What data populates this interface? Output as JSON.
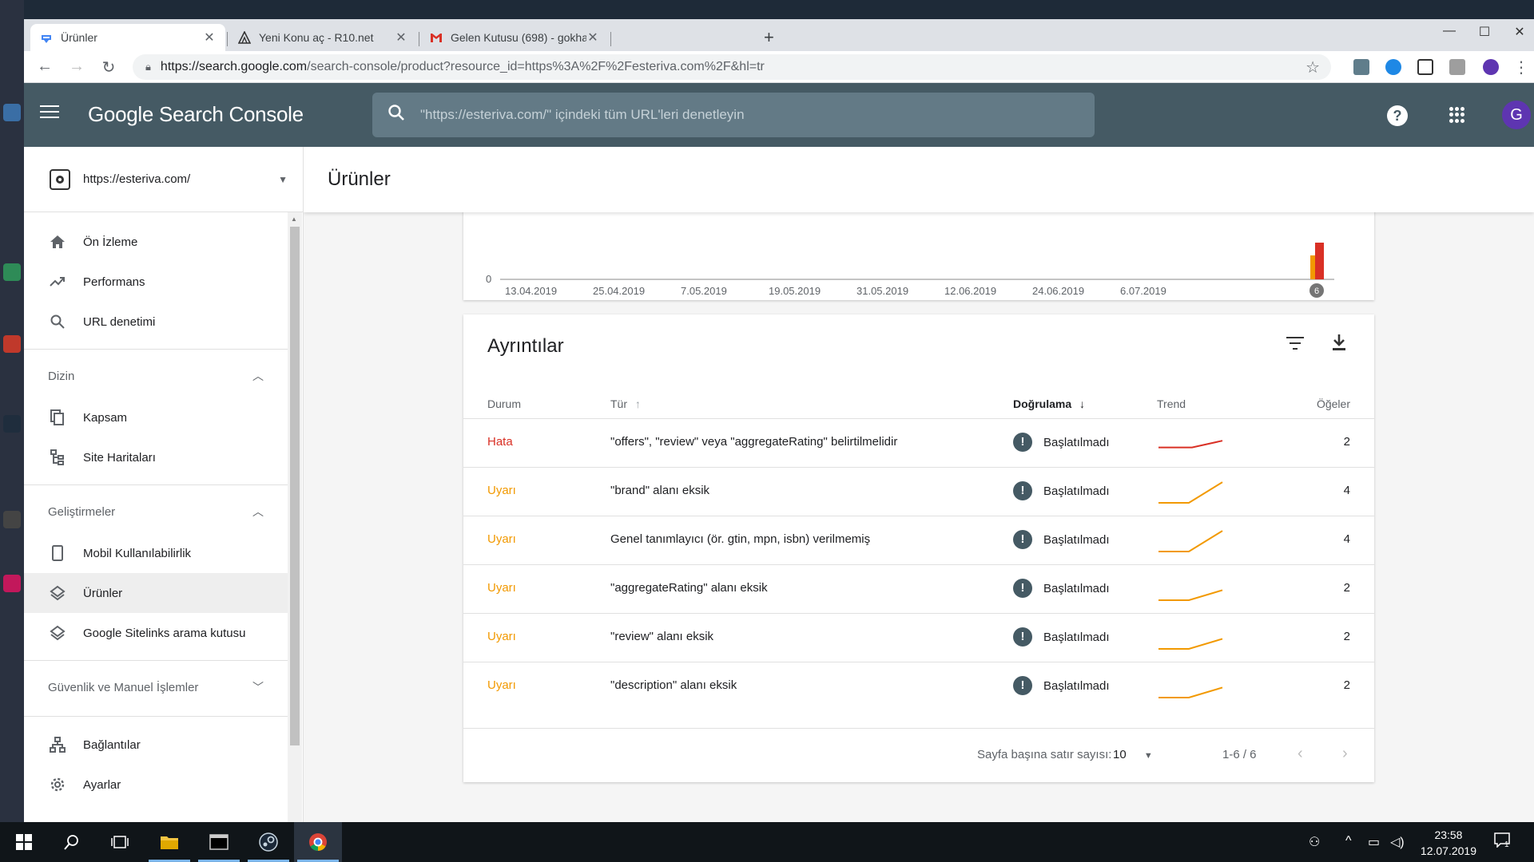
{
  "browser": {
    "tabs": [
      {
        "title": "Ürünler",
        "favicon": "search-console-icon",
        "active": true
      },
      {
        "title": "Yeni Konu aç - R10.net",
        "favicon": "r10-icon",
        "active": false
      },
      {
        "title": "Gelen Kutusu (698) - gokhanpola",
        "favicon": "gmail-icon",
        "active": false
      }
    ],
    "url_host": "https://search.google.com",
    "url_path": "/search-console/product?resource_id=https%3A%2F%2Festeriva.com%2F&hl=tr"
  },
  "header": {
    "brand_google": "Google",
    "brand_product": "Search Console",
    "search_placeholder": "\"https://esteriva.com/\" içindeki tüm URL'leri denetleyin",
    "avatar_letter": "G"
  },
  "sidebar": {
    "property": "https://esteriva.com/",
    "items_top": [
      {
        "label": "Ön İzleme",
        "icon": "home-icon"
      },
      {
        "label": "Performans",
        "icon": "trending-icon"
      },
      {
        "label": "URL denetimi",
        "icon": "search-icon"
      }
    ],
    "section_index": "Dizin",
    "items_index": [
      {
        "label": "Kapsam",
        "icon": "copy-icon"
      },
      {
        "label": "Site Haritaları",
        "icon": "sitemap-icon"
      }
    ],
    "section_enh": "Geliştirmeler",
    "items_enh": [
      {
        "label": "Mobil Kullanılabilirlik",
        "icon": "phone-icon"
      },
      {
        "label": "Ürünler",
        "icon": "layers-icon",
        "active": true
      },
      {
        "label": "Google Sitelinks arama kutusu",
        "icon": "layers-icon"
      }
    ],
    "section_security": "Güvenlik ve Manuel İşlemler",
    "items_bottom": [
      {
        "label": "Bağlantılar",
        "icon": "links-icon"
      },
      {
        "label": "Ayarlar",
        "icon": "gear-icon"
      }
    ]
  },
  "main": {
    "page_title": "Ürünler",
    "chart": {
      "y_zero_label": "0",
      "x_labels": [
        "13.04.2019",
        "25.04.2019",
        "7.05.2019",
        "19.05.2019",
        "31.05.2019",
        "12.06.2019",
        "24.06.2019",
        "6.07.2019"
      ],
      "marker_label": "6"
    },
    "details": {
      "title": "Ayrıntılar",
      "columns": {
        "status": "Durum",
        "type": "Tür",
        "validation": "Doğrulama",
        "trend": "Trend",
        "items": "Öğeler"
      },
      "rows": [
        {
          "status": "Hata",
          "type": "\"offers\", \"review\" veya \"aggregateRating\" belirtilmelidir",
          "validation": "Başlatılmadı",
          "items": "2",
          "kind": "error",
          "trend_from": 2,
          "trend_to": 2,
          "trend_peak": 1.5
        },
        {
          "status": "Uyarı",
          "type": "\"brand\" alanı eksik",
          "validation": "Başlatılmadı",
          "items": "4",
          "kind": "warning",
          "trend_from": 0,
          "trend_to": 4,
          "trend_peak": 1.6
        },
        {
          "status": "Uyarı",
          "type": "Genel tanımlayıcı (ör. gtin, mpn, isbn) verilmemiş",
          "validation": "Başlatılmadı",
          "items": "4",
          "kind": "warning",
          "trend_from": 0,
          "trend_to": 4,
          "trend_peak": 1.6
        },
        {
          "status": "Uyarı",
          "type": "\"aggregateRating\" alanı eksik",
          "validation": "Başlatılmadı",
          "items": "2",
          "kind": "warning",
          "trend_from": 0,
          "trend_to": 2,
          "trend_peak": 1.8
        },
        {
          "status": "Uyarı",
          "type": "\"review\" alanı eksik",
          "validation": "Başlatılmadı",
          "items": "2",
          "kind": "warning",
          "trend_from": 0,
          "trend_to": 2,
          "trend_peak": 1.8
        },
        {
          "status": "Uyarı",
          "type": "\"description\" alanı eksik",
          "validation": "Başlatılmadı",
          "items": "2",
          "kind": "warning",
          "trend_from": 0,
          "trend_to": 2,
          "trend_peak": 1.8
        }
      ],
      "footer": {
        "rows_per_page_label": "Sayfa başına satır sayısı:",
        "rows_per_page": "10",
        "range": "1-6 / 6"
      }
    }
  },
  "taskbar": {
    "time": "23:58",
    "date": "12.07.2019",
    "notifications": "1"
  },
  "colors": {
    "error": "#d93025",
    "warning": "#f29900",
    "header_bg": "#455a64"
  }
}
